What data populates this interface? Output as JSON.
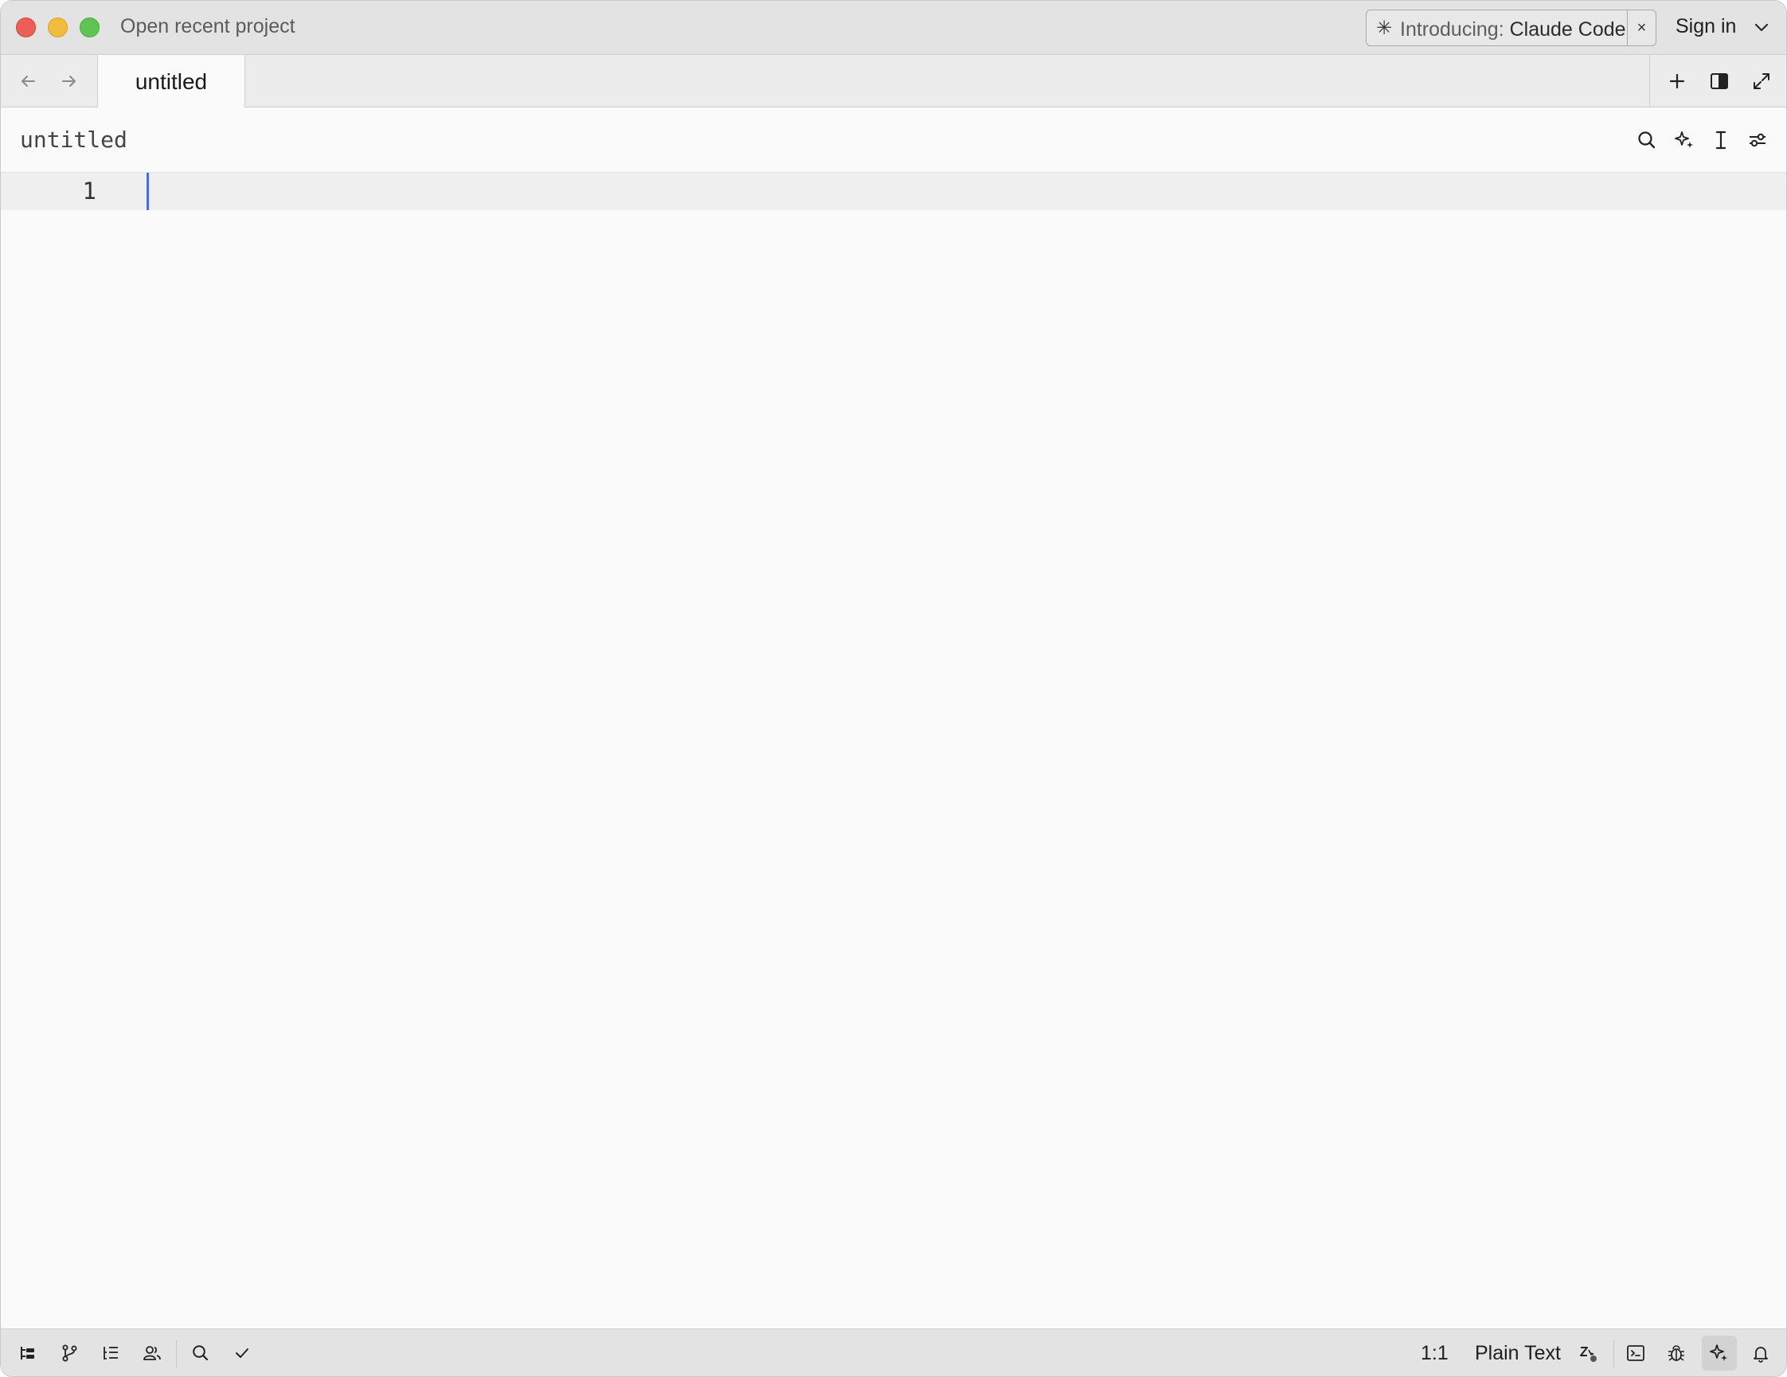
{
  "window": {
    "title": "Open recent project",
    "promo": {
      "prefix": "Introducing:",
      "product": "Claude Code",
      "close_glyph": "×",
      "icon": "sparkle-icon"
    },
    "sign_in": "Sign in"
  },
  "tabs": [
    {
      "label": "untitled",
      "active": true
    }
  ],
  "toolbar": {
    "file_title": "untitled",
    "icons": [
      "search-icon",
      "sparkle-icon",
      "text-cursor-icon",
      "sliders-icon"
    ]
  },
  "editor": {
    "lines": [
      {
        "number": "1",
        "text": ""
      }
    ],
    "caret_color": "#4e6bdc"
  },
  "statusbar": {
    "left_icons": [
      "project-panel-icon",
      "git-branch-icon",
      "outline-icon",
      "collaborators-icon",
      "search-icon",
      "check-icon"
    ],
    "cursor_position": "1:1",
    "language": "Plain Text",
    "right_icons": [
      "edit-prediction-icon",
      "terminal-icon",
      "debug-icon",
      "assistant-icon",
      "bell-icon"
    ]
  }
}
